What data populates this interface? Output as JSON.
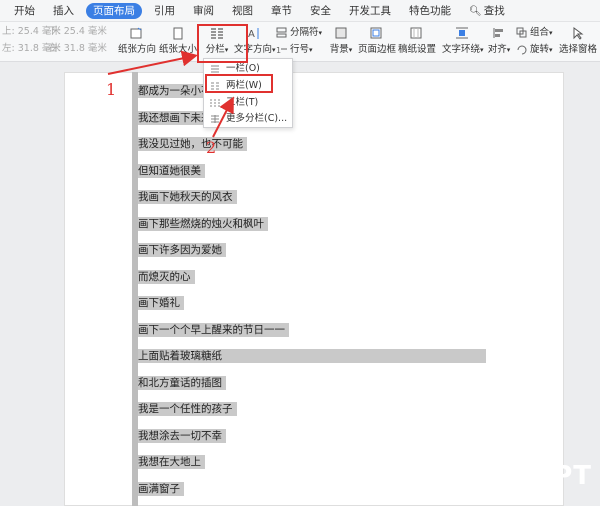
{
  "tabs": [
    {
      "label": "开始"
    },
    {
      "label": "插入"
    },
    {
      "label": "页面布局"
    },
    {
      "label": "引用"
    },
    {
      "label": "审阅"
    },
    {
      "label": "视图"
    },
    {
      "label": "章节"
    },
    {
      "label": "安全"
    },
    {
      "label": "开发工具"
    },
    {
      "label": "特色功能"
    },
    {
      "label": "查找"
    }
  ],
  "active_tab": "页面布局",
  "margins": {
    "top_label": "上:",
    "top_value": "25.4 毫米",
    "bottom_label": "下:",
    "bottom_value": "25.4 毫米",
    "left_label": "左:",
    "left_value": "31.8 毫米",
    "right_label": "右:",
    "right_value": "31.8 毫米"
  },
  "ribbon": {
    "orientation": "纸张方向",
    "size": "纸张大小",
    "columns": "分栏",
    "text_direction": "文字方向",
    "breaks": "分隔符",
    "line_numbers": "行号",
    "background": "背景",
    "page_border": "页面边框",
    "paper_setup": "稿纸设置",
    "wrap": "文字环绕",
    "align": "对齐",
    "group": "组合",
    "rotate": "旋转",
    "selection_pane": "选择窗格"
  },
  "dropdown": {
    "items": [
      {
        "label": "一栏(O)"
      },
      {
        "label": "两栏(W)"
      },
      {
        "label": "三栏(T)"
      },
      {
        "label": "更多分栏(C)..."
      }
    ]
  },
  "document_lines": [
    "都成为一朵小花",
    "我还想画下未来",
    "我没见过她，也不可能",
    "但知道她很美",
    "我画下她秋天的风衣",
    "画下那些燃烧的烛火和枫叶",
    "画下许多因为爱她",
    "而熄灭的心",
    "画下婚礼",
    "画下一个个早上醒来的节日一一",
    "上面贴着玻璃糖纸",
    "和北方童话的插图",
    "我是一个任性的孩子",
    "我想涂去一切不幸",
    "我想在大地上",
    "画满窗子"
  ],
  "annotations": {
    "label_1": "1",
    "label_2": "2"
  },
  "watermark": "PT",
  "colors": {
    "accent": "#3b7fe4",
    "annotation": "#e0312f",
    "selection": "#c9c9c9"
  }
}
